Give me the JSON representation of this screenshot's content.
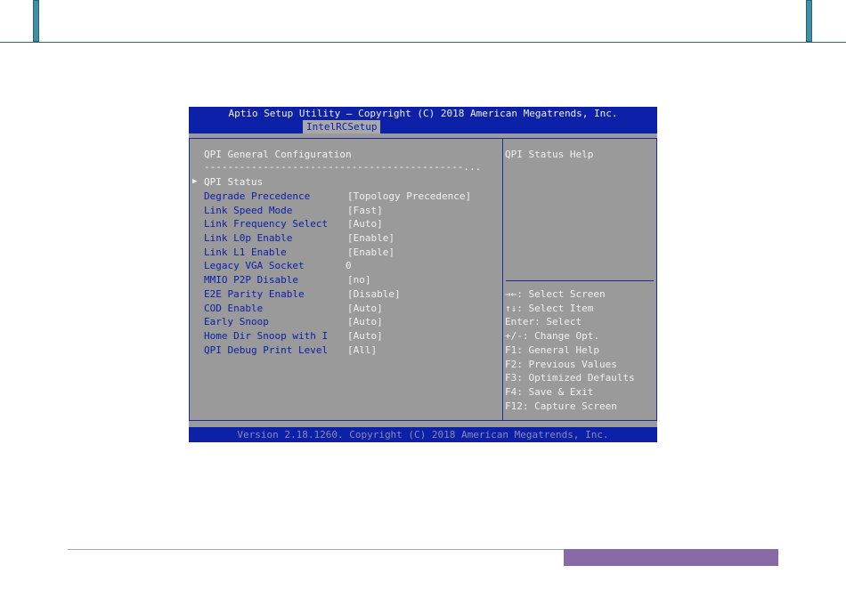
{
  "bios": {
    "title": "Aptio Setup Utility – Copyright (C) 2018 American Megatrends, Inc.",
    "active_tab": "IntelRCSetup",
    "section_title": "QPI General Configuration",
    "separator": "--------------------------------------------...",
    "submenu": "QPI Status",
    "items": [
      {
        "label": "Degrade Precedence",
        "value": "[Topology Precedence]"
      },
      {
        "label": "Link Speed Mode",
        "value": "[Fast]"
      },
      {
        "label": "Link Frequency Select",
        "value": "[Auto]"
      },
      {
        "label": "Link L0p Enable",
        "value": "[Enable]"
      },
      {
        "label": "Link L1 Enable",
        "value": "[Enable]"
      },
      {
        "label": "Legacy VGA Socket",
        "value": "0"
      },
      {
        "label": "MMIO P2P Disable",
        "value": "[no]"
      },
      {
        "label": "E2E Parity Enable",
        "value": "[Disable]"
      },
      {
        "label": "COD Enable",
        "value": "[Auto]"
      },
      {
        "label": "Early Snoop",
        "value": "[Auto]"
      },
      {
        "label": "Home Dir Snoop with I",
        "value": "[Auto]"
      },
      {
        "label": "QPI Debug Print Level",
        "value": "[All]"
      }
    ],
    "help_title": "QPI Status Help",
    "keys": [
      "→←: Select Screen",
      "↑↓: Select Item",
      "Enter: Select",
      "+/-: Change Opt.",
      "F1: General Help",
      "F2: Previous Values",
      "F3: Optimized Defaults",
      "F4: Save & Exit",
      "F12: Capture Screen"
    ],
    "version": "Version 2.18.1260. Copyright (C) 2018 American Megatrends, Inc."
  }
}
